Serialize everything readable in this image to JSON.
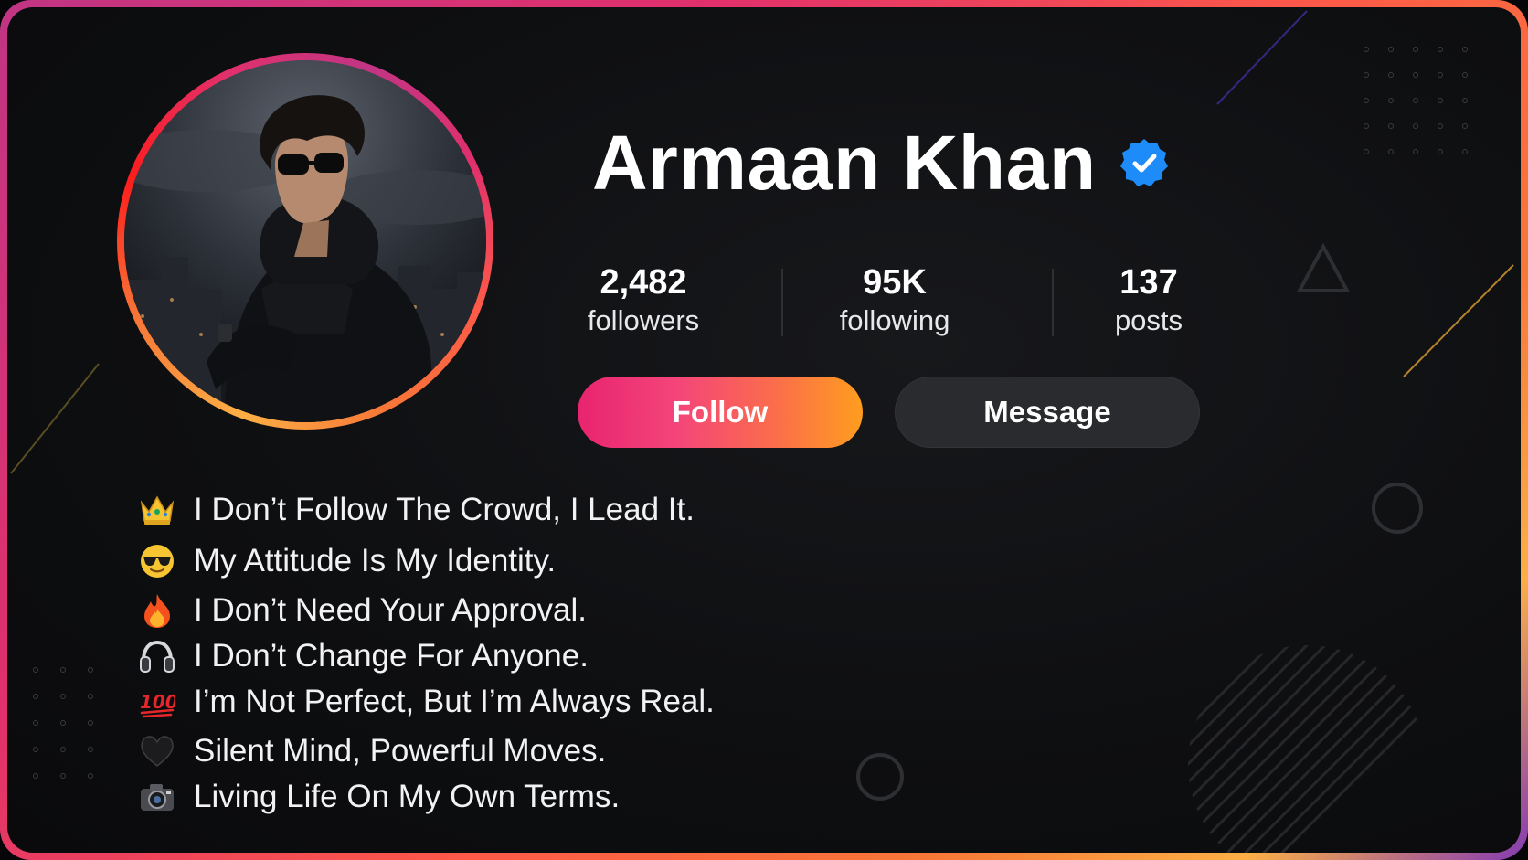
{
  "profile": {
    "name": "Armaan Khan",
    "verified": true
  },
  "stats": [
    {
      "value": "2,482",
      "label": "followers"
    },
    {
      "value": "95K",
      "label": "following"
    },
    {
      "value": "137",
      "label": "posts"
    }
  ],
  "actions": {
    "follow_label": "Follow",
    "message_label": "Message"
  },
  "bio": [
    {
      "icon": "crown-icon",
      "text": "I Don’t Follow The Crowd, I Lead It."
    },
    {
      "icon": "sunglasses-face-icon",
      "text": "My Attitude Is My Identity."
    },
    {
      "icon": "fire-icon",
      "text": "I Don’t Need Your Approval."
    },
    {
      "icon": "headphones-icon",
      "text": "I Don’t Change For Anyone."
    },
    {
      "icon": "hundred-points-icon",
      "text": "I’m Not Perfect, But I’m Always Real."
    },
    {
      "icon": "black-heart-icon",
      "text": "Silent Mind, Powerful Moves."
    },
    {
      "icon": "camera-icon",
      "text": "Living Life On My Own Terms."
    }
  ],
  "colors": {
    "verified_badge": "#1d8cf8",
    "follow_gradient_start": "#e8246f",
    "follow_gradient_end": "#ff9d1e",
    "message_button": "#2a2b2e",
    "background": "#0e0f11"
  }
}
